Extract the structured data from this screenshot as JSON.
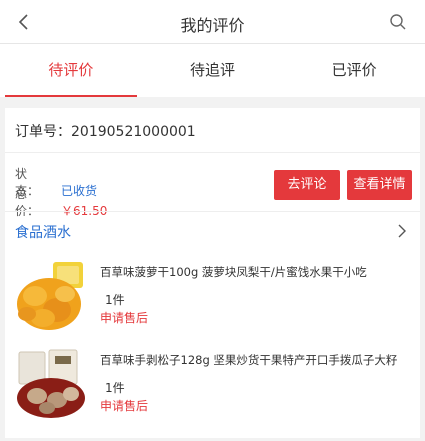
{
  "header": {
    "title": "我的评价"
  },
  "tabs": [
    {
      "label": "待评价"
    },
    {
      "label": "待追评"
    },
    {
      "label": "已评价"
    }
  ],
  "order": {
    "number_label": "订单号：20190521000001",
    "status_label": "状　态：",
    "status_value": "已收货",
    "price_label": "总　价：",
    "price_value": "￥61.50",
    "review_button": "去评论",
    "details_button": "查看详情"
  },
  "category": {
    "label": "食品酒水"
  },
  "products": [
    {
      "title": "百草味菠萝干100g 菠萝块凤梨干/片蜜饯水果干小吃",
      "qty": "1件",
      "after_sale": "申请售后"
    },
    {
      "title": "百草味手剥松子128g 坚果炒货干果特产开口手拨瓜子大籽",
      "qty": "1件",
      "after_sale": "申请售后"
    }
  ],
  "colors": {
    "accent": "#e4393c",
    "link": "#2a6fd0"
  },
  "icons": {
    "back": "chevron-left-icon",
    "search": "search-icon",
    "more": "chevron-right-icon"
  }
}
